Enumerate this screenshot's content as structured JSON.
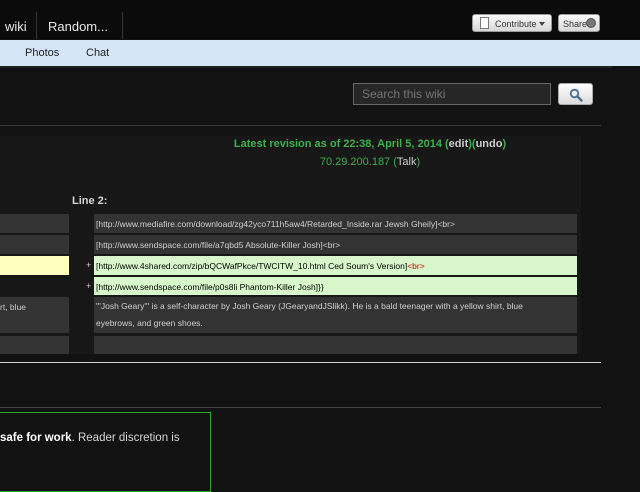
{
  "topbar": {
    "wiki_label": "wiki",
    "random_label": "Random...",
    "contribute_label": "Contribute",
    "share_label": "Share"
  },
  "nav": {
    "photos_label": "Photos",
    "chat_label": "Chat"
  },
  "search": {
    "placeholder": "Search this wiki"
  },
  "revision": {
    "prefix": "Latest revision as of 22:38, April 5, 2014",
    "open_paren": " (",
    "edit_label": "edit",
    "mid_paren": ")(",
    "undo_label": "undo",
    "close_paren": ")",
    "ip": "70.29.200.187",
    "talk_open": " (",
    "talk_label": "Talk",
    "talk_close": ")"
  },
  "diff": {
    "line_label": "Line 2:",
    "rows": [
      {
        "text": "[http://www.mediafire.com/download/zg42yco711h5aw4/Retarded_Inside.rar Jewsh Gheily]<br>"
      },
      {
        "text": "[http://www.sendspace.com/file/a7qbd5 Absolute-Killer Josh]<br>"
      },
      {
        "text": "[http://www.4shared.com/zip/bQCWafPkce/TWCITW_10.html Ced Soum's Version]",
        "tail": "<br>"
      },
      {
        "text": "[http://www.sendspace.com/file/p0s8li Phantom-Killer Josh]}}"
      },
      {
        "text_line1": "'''Josh Geary''' is a self-character by Josh Geary (JGearyandJSlikk). He is a bald teenager with a yellow shirt, blue",
        "text_line2": "eyebrows, and green shoes."
      }
    ],
    "left_fragment": "rt, blue",
    "plus_sign": "+"
  },
  "notice": {
    "bold": "safe for work",
    "rest": ". Reader discretion is"
  }
}
